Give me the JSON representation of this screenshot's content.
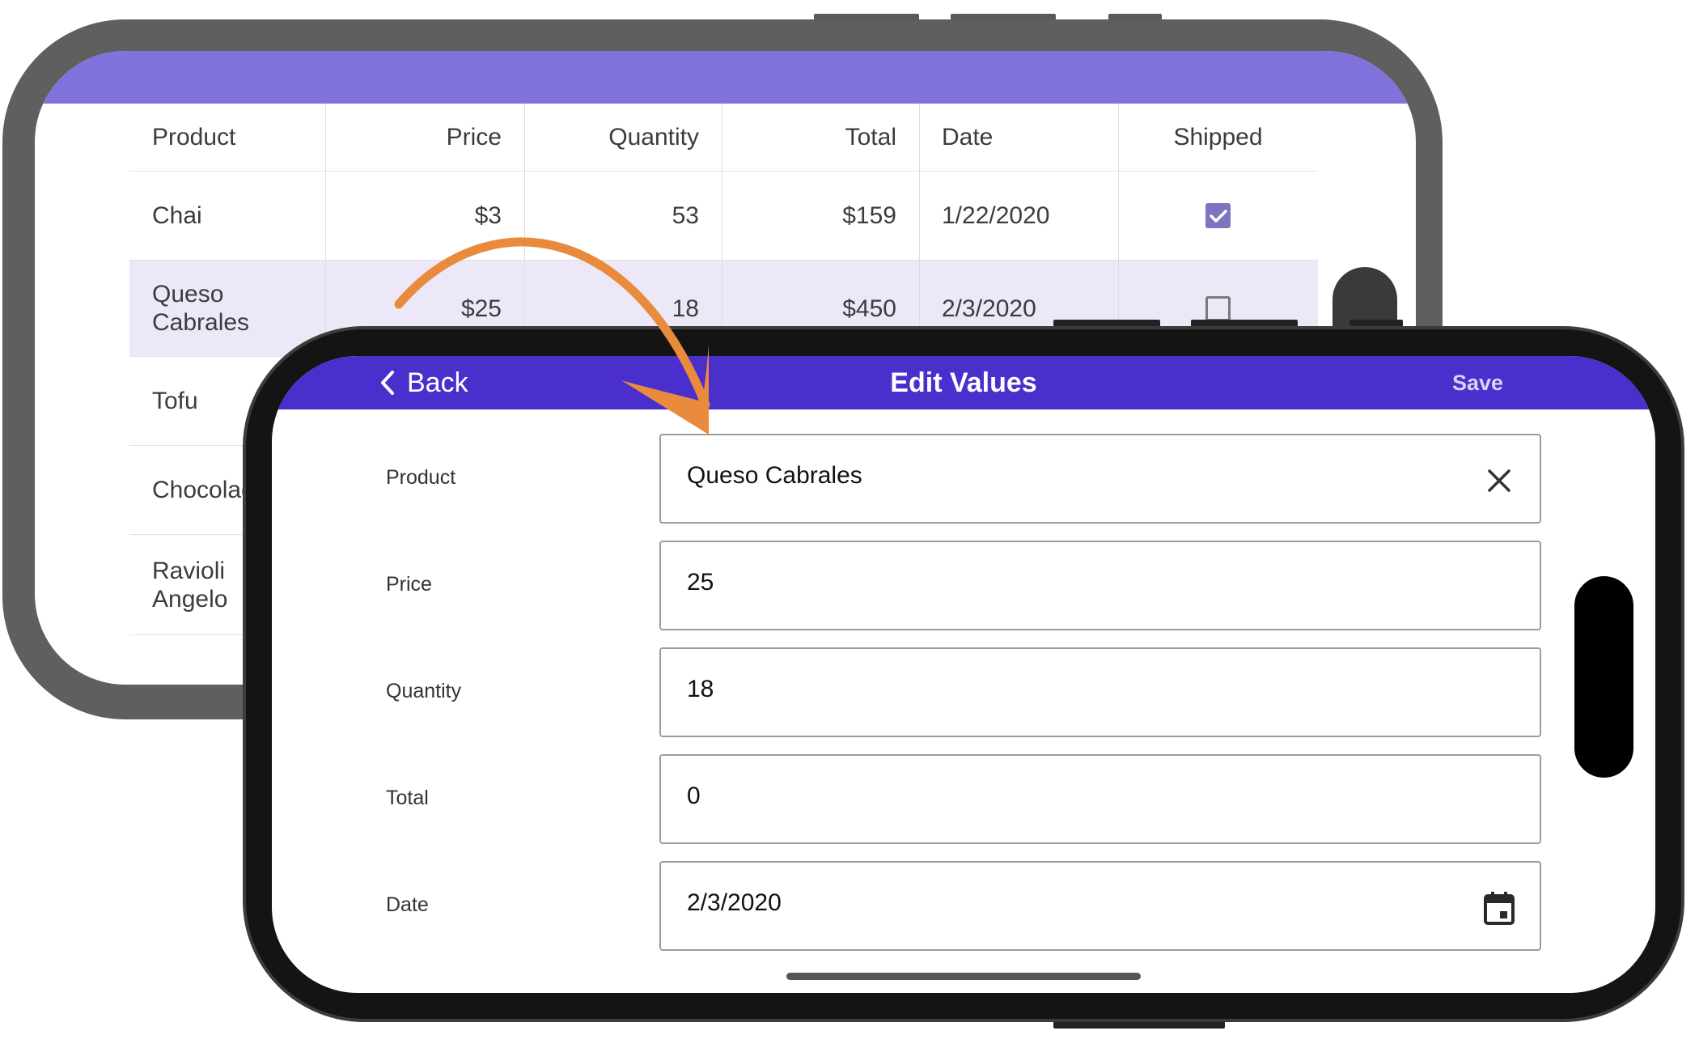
{
  "colors": {
    "back_header": "#8073dc",
    "front_header": "#4a2fcc",
    "selected_row": "#ece8f7",
    "checkbox_on": "#7e75c0",
    "arrow": "#ea8a3c"
  },
  "grid": {
    "columns": [
      "Product",
      "Price",
      "Quantity",
      "Total",
      "Date",
      "Shipped"
    ],
    "rows": [
      {
        "product": "Chai",
        "price": "$3",
        "quantity": "53",
        "total": "$159",
        "date": "1/22/2020",
        "shipped": true,
        "selected": false
      },
      {
        "product": "Queso Cabrales",
        "price": "$25",
        "quantity": "18",
        "total": "$450",
        "date": "2/3/2020",
        "shipped": false,
        "selected": true
      },
      {
        "product": "Tofu",
        "price": "",
        "quantity": "",
        "total": "",
        "date": "",
        "shipped": null,
        "selected": false
      },
      {
        "product": "Chocolade",
        "price": "",
        "quantity": "",
        "total": "",
        "date": "",
        "shipped": null,
        "selected": false
      },
      {
        "product": "Ravioli Angelo",
        "price": "",
        "quantity": "",
        "total": "",
        "date": "",
        "shipped": null,
        "selected": false
      }
    ]
  },
  "edit_form": {
    "back_label": "Back",
    "title": "Edit Values",
    "save_label": "Save",
    "fields": [
      {
        "label": "Product",
        "value": "Queso Cabrales",
        "icon": "clear-icon"
      },
      {
        "label": "Price",
        "value": "25",
        "icon": ""
      },
      {
        "label": "Quantity",
        "value": "18",
        "icon": ""
      },
      {
        "label": "Total",
        "value": "0",
        "icon": ""
      },
      {
        "label": "Date",
        "value": "2/3/2020",
        "icon": "calendar-icon"
      }
    ]
  }
}
